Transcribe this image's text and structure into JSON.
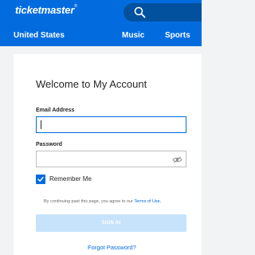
{
  "header": {
    "logo_text": "ticketmaster",
    "logo_mark": "®",
    "search_icon": "search-icon",
    "brand_color": "#026cdf"
  },
  "nav": {
    "location": "United States",
    "items": [
      {
        "label": "Music"
      },
      {
        "label": "Sports"
      }
    ]
  },
  "login": {
    "title": "Welcome to My Account",
    "email_label": "Email Address",
    "email_value": "",
    "password_label": "Password",
    "password_value": "",
    "password_icon": "eye-icon",
    "remember_label": "Remember Me",
    "remember_checked": true,
    "disclaimer_prefix": "By continuing past this page, you agree to our ",
    "disclaimer_link": "Terms of Use.",
    "signin_label": "SIGN IN",
    "forgot_label": "Forgot Password?"
  }
}
